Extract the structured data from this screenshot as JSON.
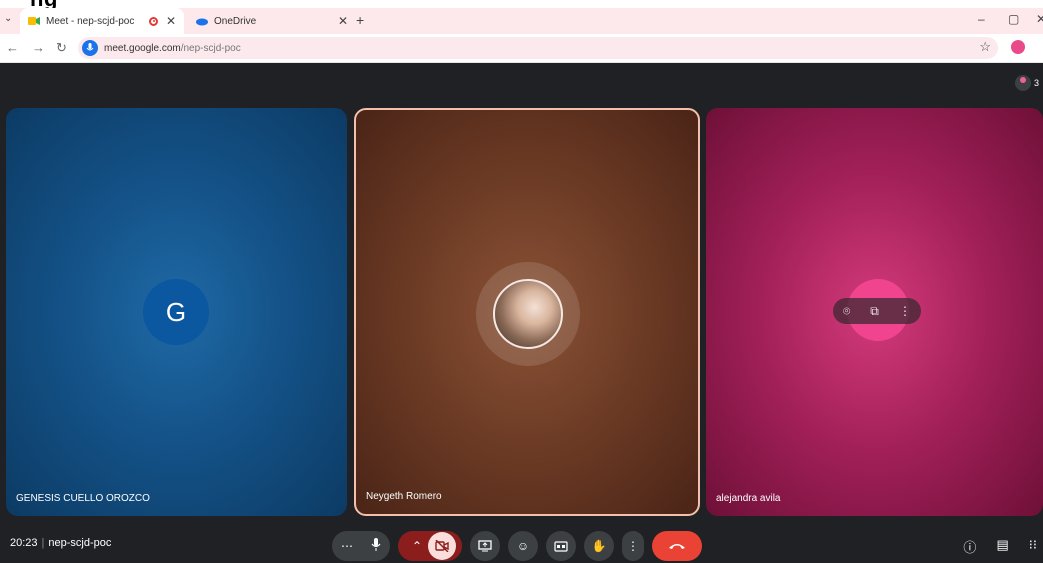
{
  "browser": {
    "top_text": "ng",
    "tabs": [
      {
        "title": "Meet - nep-scjd-poc",
        "active": true
      },
      {
        "title": "OneDrive",
        "active": false
      }
    ],
    "new_tab": "+",
    "window_controls": [
      "–",
      "▢",
      "✕"
    ],
    "address": {
      "host": "meet.google.com",
      "path": "/nep-scjd-poc"
    }
  },
  "meet": {
    "participant_count": "3",
    "participants": [
      {
        "name": "GENESIS CUELLO OROZCO",
        "initial": "G",
        "color": "#0b57a0"
      },
      {
        "name": "Neygeth Romero",
        "speaking": true
      },
      {
        "name": "alejandra avila",
        "color": "#f0448f"
      }
    ],
    "time": "20:23",
    "separator": "|",
    "meeting_code": "nep-scjd-poc"
  }
}
